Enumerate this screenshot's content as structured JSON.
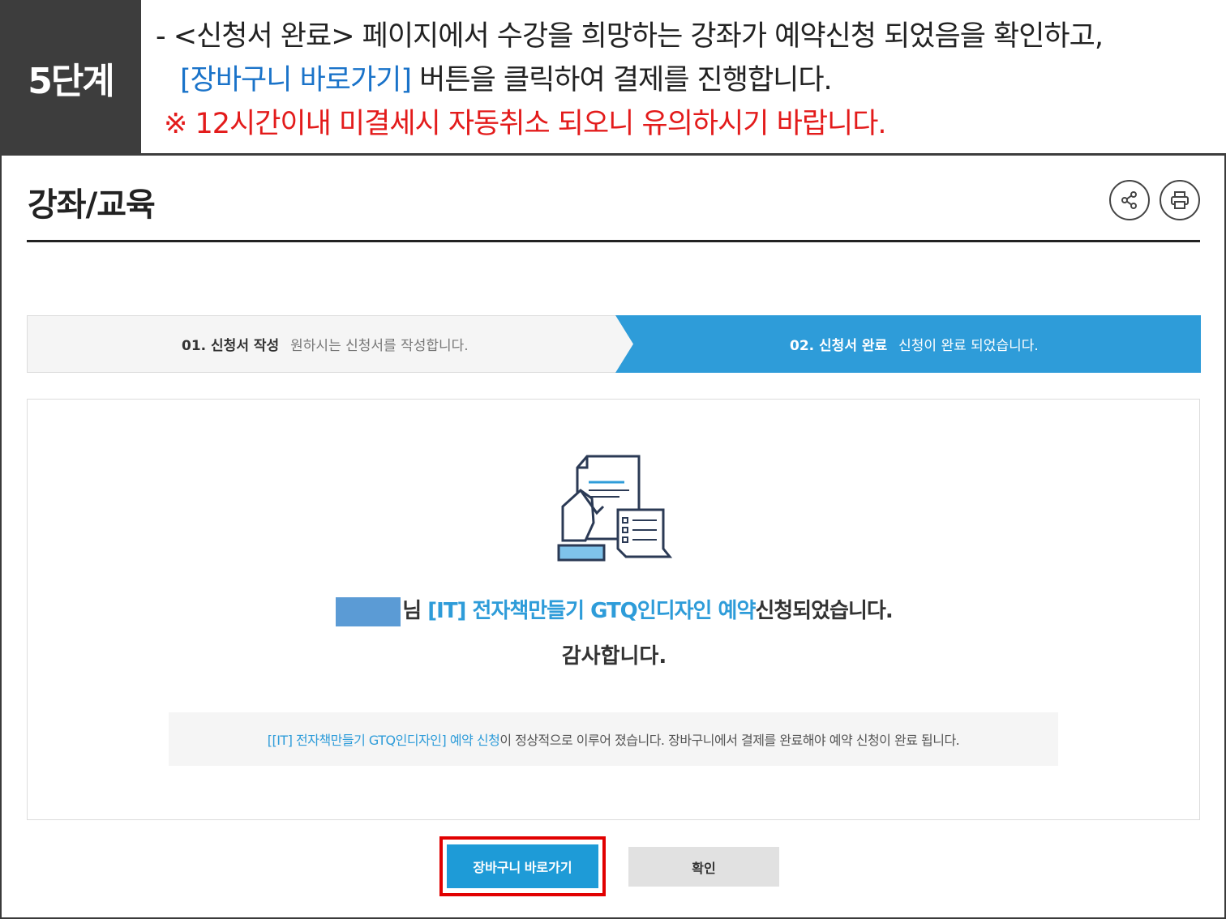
{
  "banner": {
    "step_label": "5단계",
    "line1": "- <신청서 완료> 페이지에서 수강을 희망하는 강좌가 예약신청 되었음을 확인하고,",
    "line2_highlight": "[장바구니 바로가기]",
    "line2_rest": " 버튼을 클릭하여 결제를 진행합니다.",
    "line3": "※ 12시간이내 미결세시 자동취소 되오니 유의하시기 바랍니다."
  },
  "header": {
    "title": "강좌/교육",
    "share_icon": "share-icon",
    "print_icon": "printer-icon"
  },
  "steps": {
    "step1_num": "01. 신청서 작성",
    "step1_desc": "원하시는 신청서를 작성합니다.",
    "step2_num": "02. 신청서 완료",
    "step2_desc": "신청이 완료 되었습니다.",
    "active_color": "#2e9cd9"
  },
  "content": {
    "name_suffix": "님 ",
    "course_title": "[IT] 전자책만들기 GTQ인디자인",
    "reservation_word": " 예약",
    "msg_suffix": "신청되었습니다.",
    "thanks": "감사합니다.",
    "notice_link": "[[IT] 전자책만들기 GTQ인디자인] 예약 신청",
    "notice_rest": "이 정상적으로 이루어 졌습니다.  장바구니에서 결제를 완료해야 예약 신청이 완료 됩니다."
  },
  "buttons": {
    "cart_label": "장바구니 바로가기",
    "ok_label": "확인"
  },
  "colors": {
    "accent": "#2e9cd9",
    "highlight": "#e10000",
    "instruction_blue": "#1a73c9",
    "warning_red": "#e31b1b"
  }
}
